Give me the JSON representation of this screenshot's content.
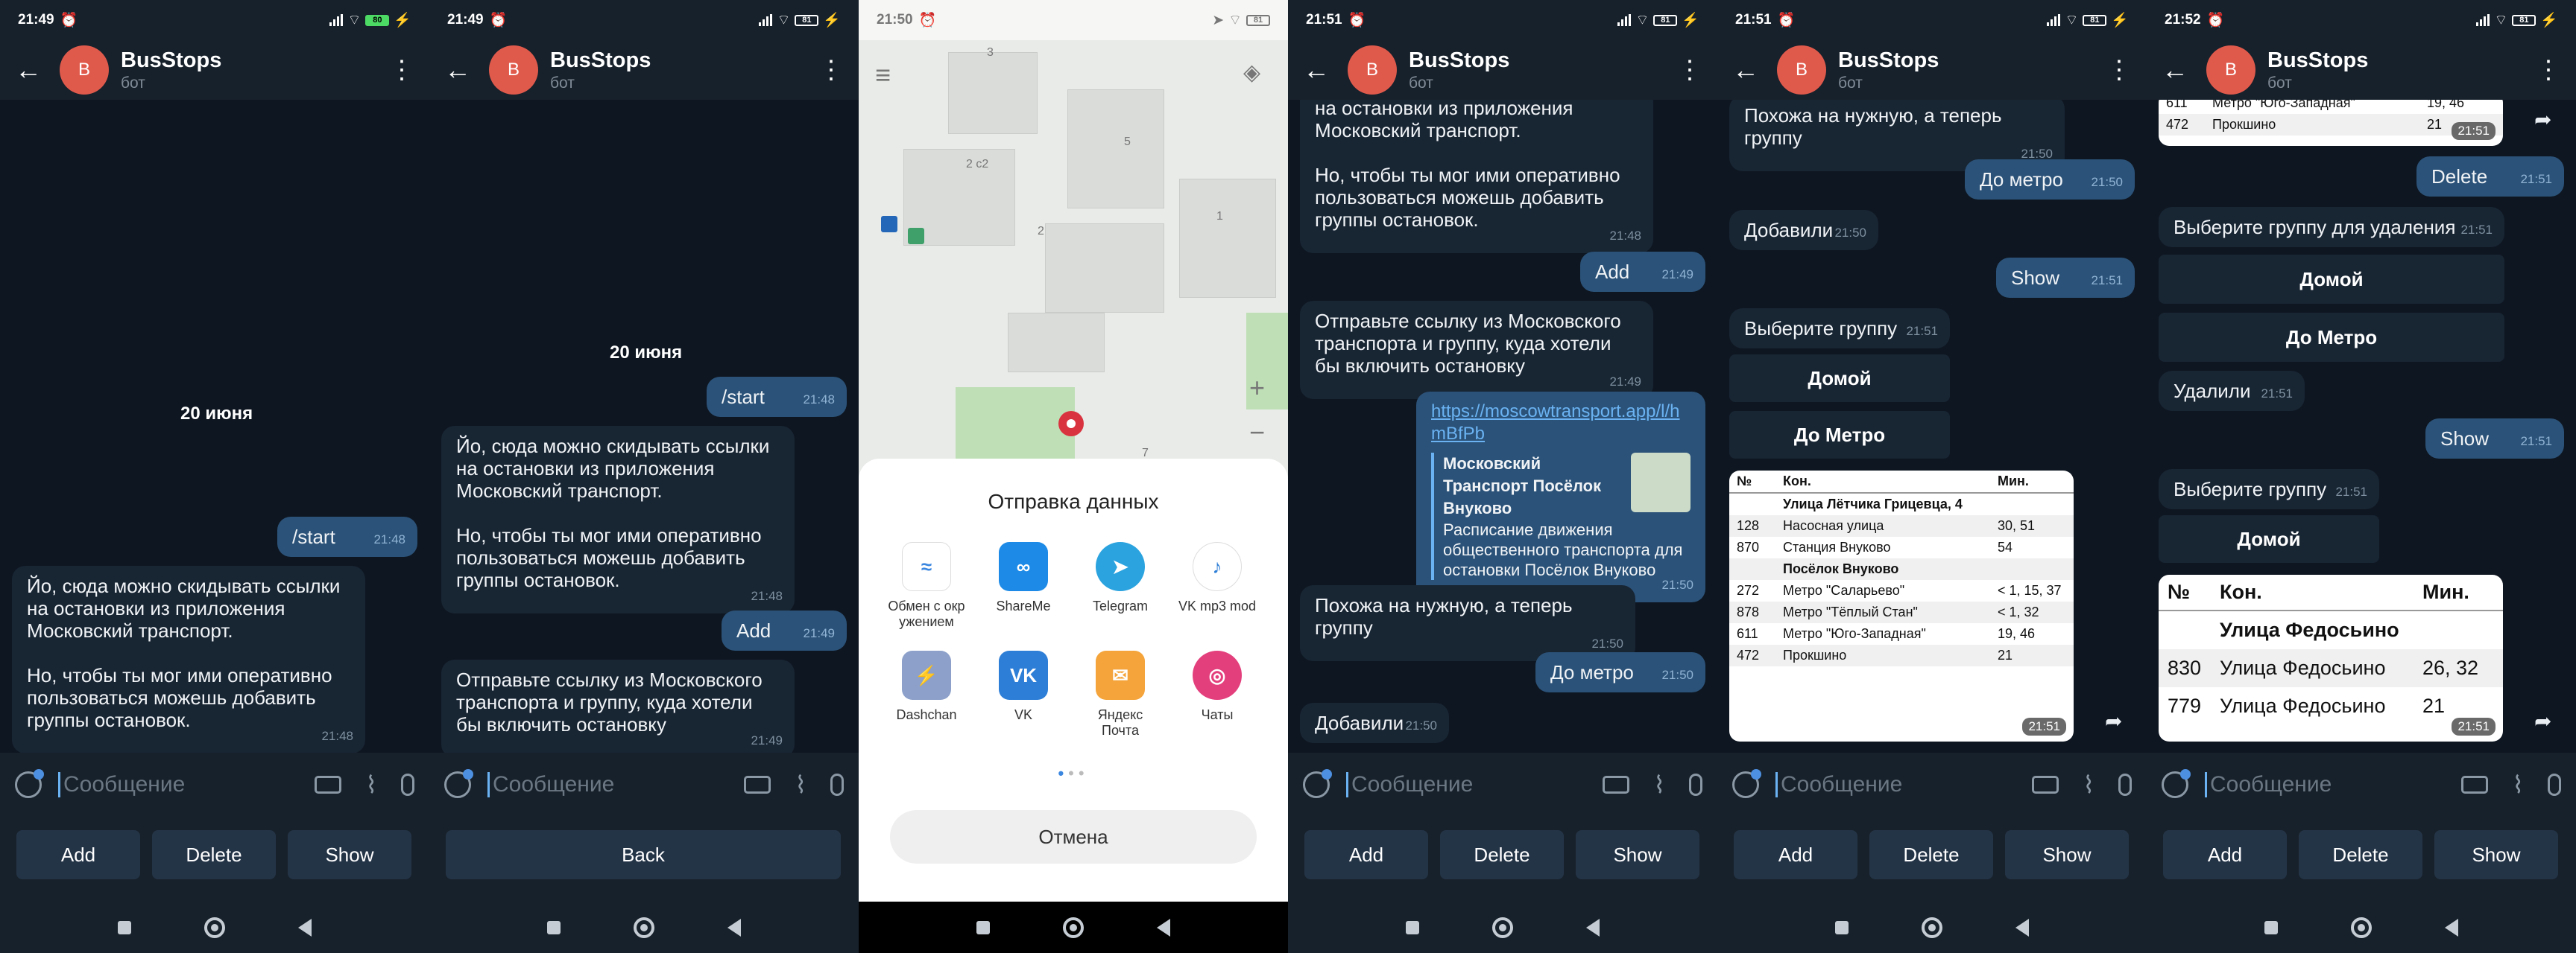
{
  "common": {
    "bot_name": "BusStops",
    "bot_sub": "бот",
    "avatar_letter": "B",
    "input_placeholder": "Сообщение",
    "btn_add": "Add",
    "btn_delete": "Delete",
    "btn_show": "Show",
    "btn_back": "Back"
  },
  "phones": [
    {
      "time": "21:49",
      "battery": "80"
    },
    {
      "time": "21:49",
      "battery": "81"
    },
    {
      "time": "21:50",
      "battery": "81"
    },
    {
      "time": "21:51",
      "battery": "81"
    },
    {
      "time": "21:51",
      "battery": "81"
    },
    {
      "time": "21:52",
      "battery": "81"
    }
  ],
  "msgs": {
    "date": "20 июня",
    "start": "/start",
    "t_start": "21:48",
    "welcome_1": "Йо, сюда можно скидывать ссылки на остановки из приложения Московский транспорт.",
    "welcome_2": "Но, чтобы ты мог ими оперативно пользоваться можешь добавить группы остановок.",
    "welcome_tail": "на остановки из приложения Московский транспорт.",
    "t_welcome": "21:48",
    "add": "Add",
    "t_add": "21:49",
    "send_link": "Отправьте ссылку из Московского транспорта и группу, куда хотели бы включить остановку",
    "t_send_link": "21:49",
    "link_url": "https://moscowtransport.app/l/hmBfPb",
    "link_title": "Московский Транспорт Посёлок Внуково",
    "link_desc": "Расписание движения общественного транспорта для остановки Посёлок Внуково",
    "t_link": "21:50",
    "looks_right": "Похожа на нужную, а теперь группу",
    "t_looks_right": "21:50",
    "to_metro": "До метро",
    "t_to_metro": "21:50",
    "added": "Добавили",
    "t_added": "21:50",
    "show": "Show",
    "t_show": "21:51",
    "choose_group": "Выберите группу",
    "t_choose_group": "21:51",
    "grp_home": "Домой",
    "grp_metro": "До Метро",
    "delete": "Delete",
    "t_delete": "21:51",
    "choose_del": "Выберите группу для удаления",
    "t_choose_del": "21:51",
    "removed": "Удалили",
    "t_removed": "21:51",
    "t_show2": "21:51",
    "t_choose2": "21:51"
  },
  "table1": {
    "headers": [
      "№",
      "Кон.",
      "Мин."
    ],
    "sect1": "Улица Лётчика Грицевца, 4",
    "rows1": [
      [
        "128",
        "Насосная улица",
        "30, 51"
      ],
      [
        "870",
        "Станция Внуково",
        "54"
      ]
    ],
    "sect2": "Посёлок Внуково",
    "rows2": [
      [
        "272",
        "Метро \"Саларьево\"",
        "< 1, 15, 37"
      ],
      [
        "878",
        "Метро \"Тёплый Стан\"",
        "< 1, 32"
      ],
      [
        "611",
        "Метро \"Юго-Западная\"",
        "19, 46"
      ],
      [
        "472",
        "Прокшино",
        "21"
      ]
    ],
    "time": "21:51"
  },
  "table_top": {
    "rows": [
      [
        "611",
        "Метро \"Юго-Западная\"",
        "19, 46"
      ],
      [
        "472",
        "Прокшино",
        "21"
      ]
    ],
    "time": "21:51"
  },
  "table2": {
    "headers": [
      "№",
      "Кон.",
      "Мин."
    ],
    "sect": "Улица Федосьино",
    "rows": [
      [
        "830",
        "Улица Федосьино",
        "26, 32"
      ],
      [
        "779",
        "Улица Федосьино",
        "21"
      ]
    ],
    "time": "21:51"
  },
  "share": {
    "title": "Отправка данных",
    "apps": [
      {
        "name": "Обмен с окружением",
        "label_l1": "Обмен с окр",
        "label_l2": "ужением",
        "color": "#ffffff",
        "glyph": "≈"
      },
      {
        "name": "ShareMe",
        "label_l1": "ShareMe",
        "label_l2": "",
        "color": "#1c8ae6",
        "glyph": "∞"
      },
      {
        "name": "Telegram",
        "label_l1": "Telegram",
        "label_l2": "",
        "color": "#2aa3df",
        "glyph": "➤"
      },
      {
        "name": "VK mp3 mod",
        "label_l1": "VK mp3 mod",
        "label_l2": "",
        "color": "#ffffff",
        "glyph": "♪"
      },
      {
        "name": "Dashchan",
        "label_l1": "Dashchan",
        "label_l2": "",
        "color": "#8ca0c9",
        "glyph": "⚡"
      },
      {
        "name": "VK",
        "label_l1": "VK",
        "label_l2": "",
        "color": "#2d7ed6",
        "glyph": "VK"
      },
      {
        "name": "Яндекс Почта",
        "label_l1": "Яндекс",
        "label_l2": "Почта",
        "color": "#f4a43a",
        "glyph": "✉"
      },
      {
        "name": "Чаты",
        "label_l1": "Чаты",
        "label_l2": "",
        "color": "#e33f7c",
        "glyph": "◎"
      }
    ],
    "cancel": "Отмена",
    "map_numbers": [
      "3",
      "2 с2",
      "5",
      "2",
      "1",
      "7"
    ]
  }
}
